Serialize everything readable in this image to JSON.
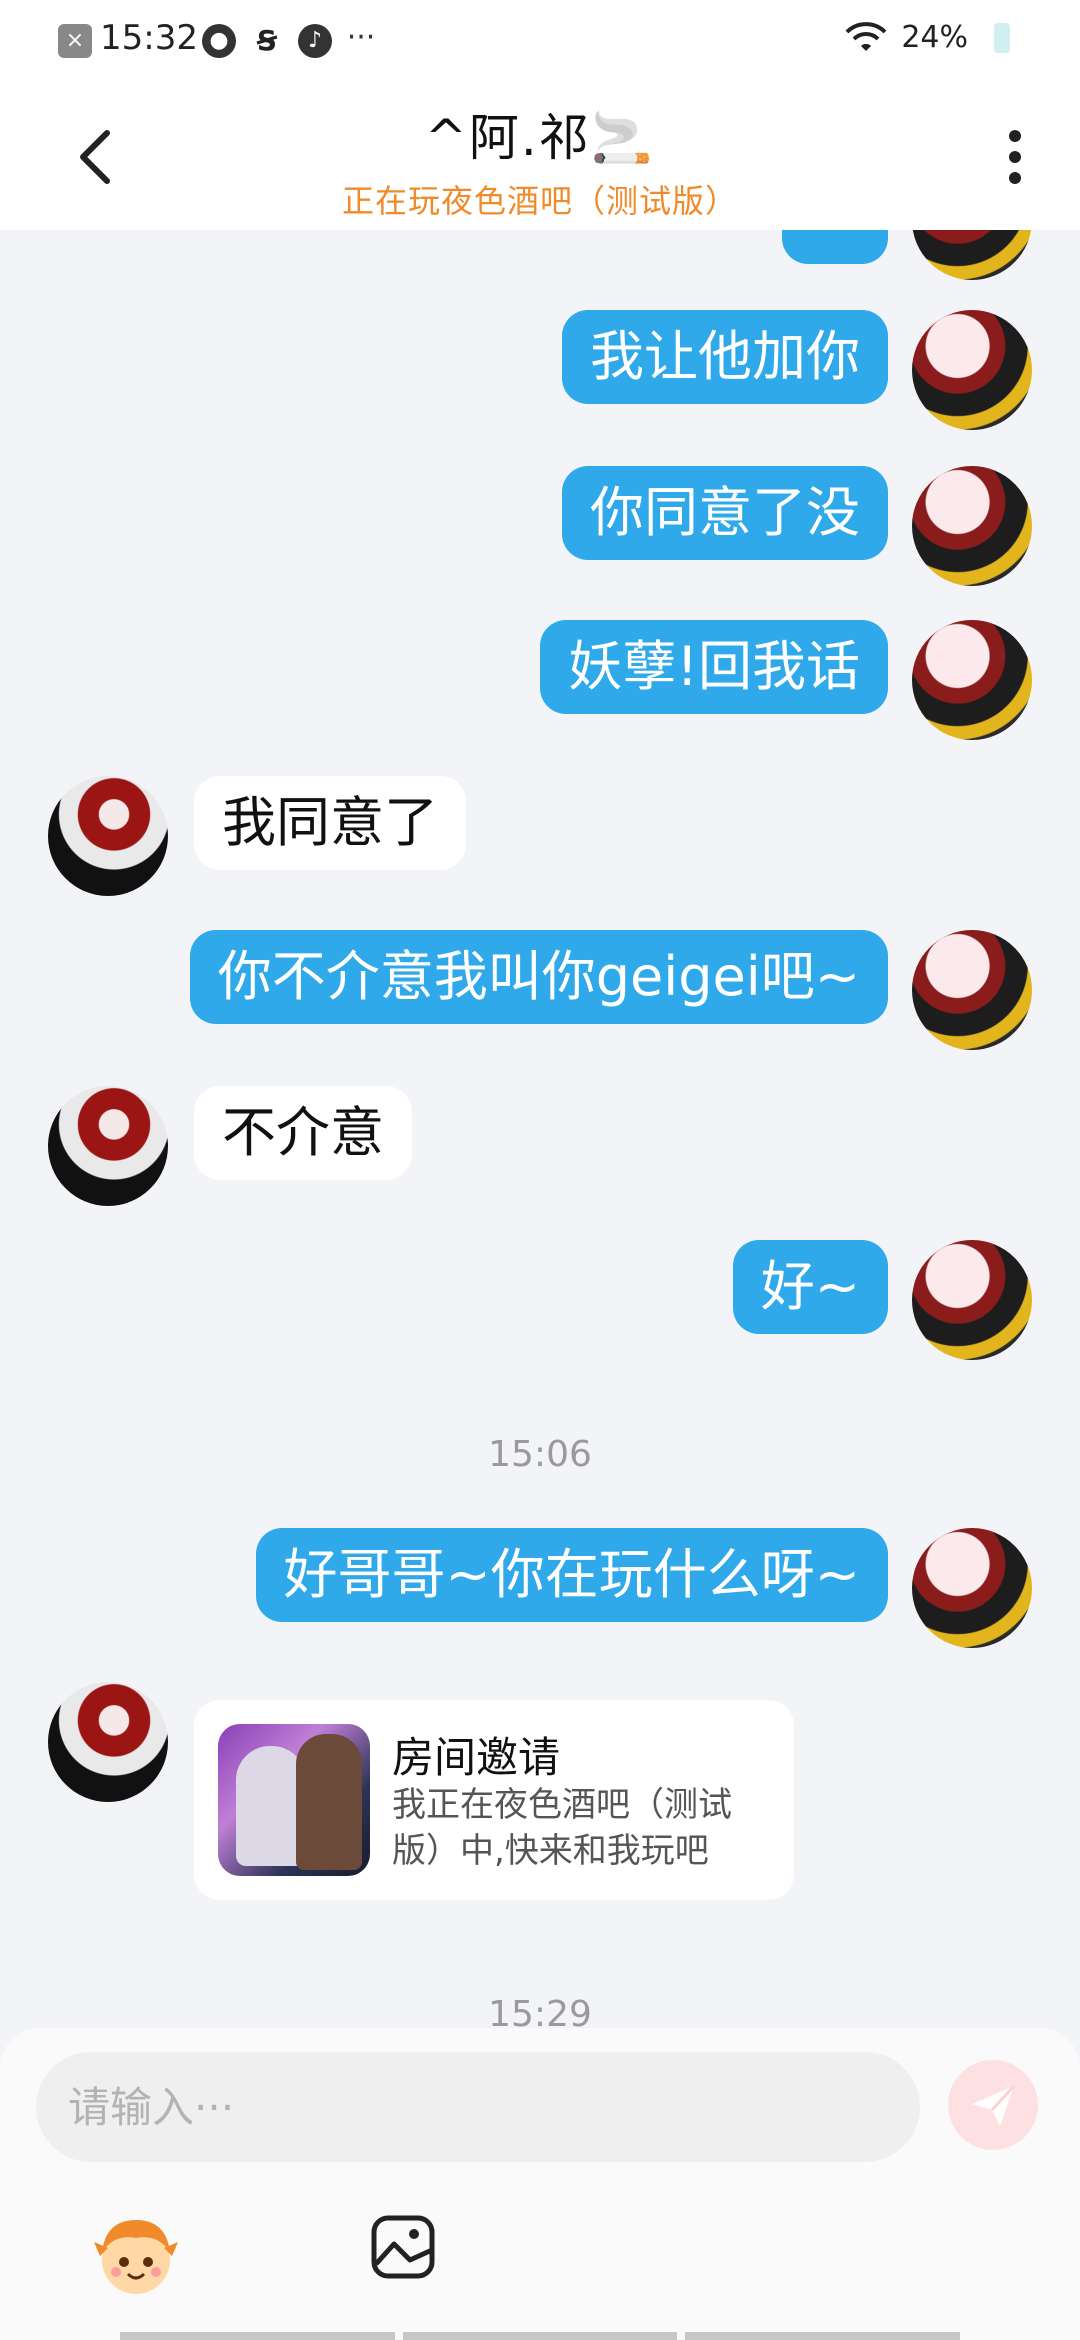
{
  "status_bar": {
    "time": "15:32",
    "battery": "24%",
    "more": "···"
  },
  "header": {
    "title": "^阿.祁🚬",
    "subtitle": "正在玩夜色酒吧（测试版）"
  },
  "messages": [
    {
      "from": "me",
      "text": "我让他加你"
    },
    {
      "from": "me",
      "text": "你同意了没"
    },
    {
      "from": "me",
      "text": "妖孽!回我话"
    },
    {
      "from": "other",
      "text": "我同意了"
    },
    {
      "from": "me",
      "text": "你不介意我叫你geigei吧~"
    },
    {
      "from": "other",
      "text": "不介意"
    },
    {
      "from": "me",
      "text": "好~"
    },
    {
      "from": "me",
      "text": "好哥哥~你在玩什么呀~"
    }
  ],
  "time_separators": [
    "15:06",
    "15:29"
  ],
  "invite_card": {
    "title": "房间邀请",
    "description": "我正在夜色酒吧（测试版）中,快来和我玩吧"
  },
  "input": {
    "placeholder": "请输入···"
  },
  "colors": {
    "my_bubble": "#2fa9ea",
    "other_bubble": "#ffffff",
    "subtitle": "#f08a2a",
    "background": "#f2f4f7"
  },
  "icons": [
    "back-arrow-icon",
    "more-vertical-icon",
    "send-icon",
    "emoji-icon",
    "image-icon",
    "wifi-icon",
    "battery-icon"
  ]
}
